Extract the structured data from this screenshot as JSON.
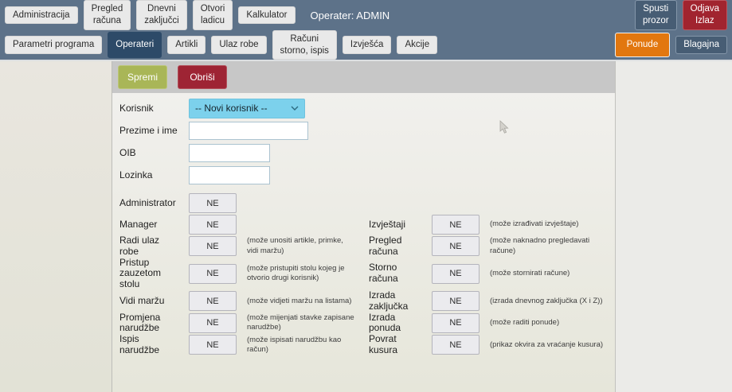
{
  "topbar": {
    "buttons": [
      {
        "label": "Administracija"
      },
      {
        "label": "Pregled\nračuna"
      },
      {
        "label": "Dnevni\nzaključci"
      },
      {
        "label": "Otvori\nladicu"
      },
      {
        "label": "Kalkulator"
      }
    ],
    "operator": "Operater: ADMIN",
    "right": [
      {
        "label": "Spusti\nprozor",
        "style": "slate"
      },
      {
        "label": "Odjava\nIzlaz",
        "style": "red"
      }
    ]
  },
  "navbar": {
    "buttons": [
      {
        "label": "Parametri programa",
        "active": false
      },
      {
        "label": "Operateri",
        "active": true
      },
      {
        "label": "Artikli",
        "active": false
      },
      {
        "label": "Ulaz robe",
        "active": false
      },
      {
        "label": "Računi\nstorno, ispis",
        "active": false
      },
      {
        "label": "Izvješća",
        "active": false
      },
      {
        "label": "Akcije",
        "active": false
      }
    ],
    "right": [
      {
        "label": "Ponude",
        "style": "orange"
      },
      {
        "label": "Blagajna",
        "style": "slate"
      }
    ]
  },
  "panel": {
    "save_label": "Spremi",
    "delete_label": "Obriši",
    "fields": {
      "korisnik_label": "Korisnik",
      "korisnik_value": "-- Novi korisnik --",
      "prezime_label": "Prezime i ime",
      "prezime_value": "",
      "oib_label": "OIB",
      "oib_value": "",
      "lozinka_label": "Lozinka",
      "lozinka_value": ""
    },
    "permissions": {
      "left": [
        {
          "label": "Administrator",
          "value": "NE",
          "hint": ""
        },
        {
          "label": "Manager",
          "value": "NE",
          "hint": ""
        },
        {
          "label": "Radi ulaz robe",
          "value": "NE",
          "hint": "(može unositi artikle, primke, vidi maržu)"
        },
        {
          "label": "Pristup zauzetom stolu",
          "value": "NE",
          "hint": "(može pristupiti stolu kojeg je otvorio drugi korisnik)"
        },
        {
          "label": "Vidi maržu",
          "value": "NE",
          "hint": "(može vidjeti maržu na listama)"
        },
        {
          "label": "Promjena narudžbe",
          "value": "NE",
          "hint": "(može mijenjati stavke zapisane narudžbe)"
        },
        {
          "label": "Ispis narudžbe",
          "value": "NE",
          "hint": "(može ispisati narudžbu kao račun)"
        }
      ],
      "right": [
        {
          "label": "Izvještaji",
          "value": "NE",
          "hint": "(može izrađivati izvještaje)"
        },
        {
          "label": "Pregled računa",
          "value": "NE",
          "hint": "(može naknadno pregledavati račune)"
        },
        {
          "label": "Storno računa",
          "value": "NE",
          "hint": "(može stornirati račune)"
        },
        {
          "label": "Izrada zaključka",
          "value": "NE",
          "hint": "(izrada dnevnog zaključka (X i Z))"
        },
        {
          "label": "Izrada ponuda",
          "value": "NE",
          "hint": "(može raditi ponude)"
        },
        {
          "label": "Povrat kusura",
          "value": "NE",
          "hint": "(prikaz okvira za vraćanje kusura)"
        }
      ]
    }
  },
  "colors": {
    "toolbar": "#5d7289",
    "active_tab": "#2d4a68",
    "save_green": "#a9b657",
    "delete_red": "#9e2434",
    "logout_red": "#a1242f",
    "offers_orange": "#e2770f",
    "dropdown_blue": "#7cd1ec"
  }
}
